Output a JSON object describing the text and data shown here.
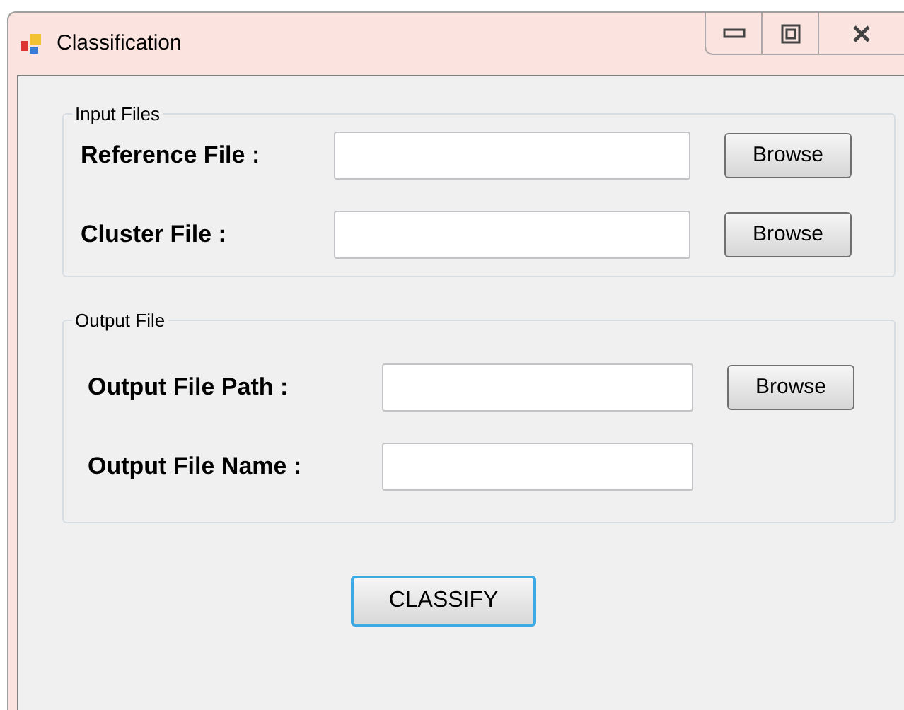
{
  "window": {
    "title": "Classification"
  },
  "groups": [
    {
      "title": "Input Files",
      "rows": [
        {
          "label": "Reference File :",
          "button": "Browse"
        },
        {
          "label": "Cluster File :",
          "button": "Browse"
        }
      ]
    },
    {
      "title": "Output File",
      "rows": [
        {
          "label": "Output File Path :",
          "button": "Browse"
        },
        {
          "label": "Output File Name :"
        }
      ]
    }
  ],
  "action_button": {
    "label": "CLASSIFY",
    "focused": true
  }
}
